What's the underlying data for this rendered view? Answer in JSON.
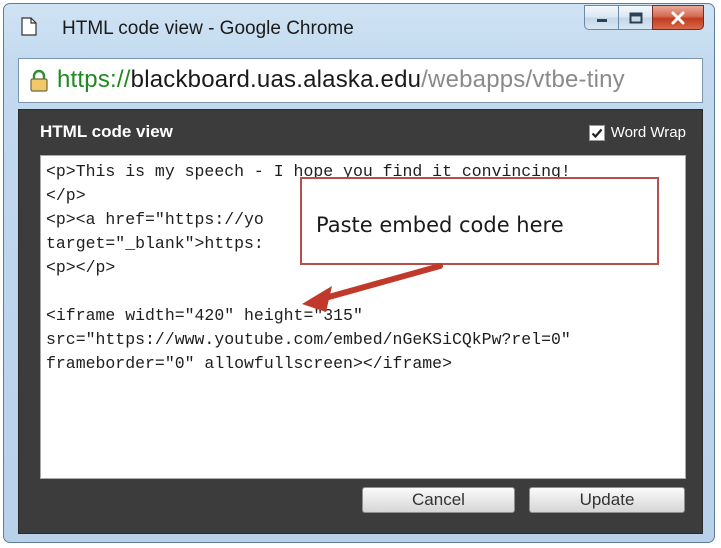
{
  "window": {
    "title": "HTML code view - Google Chrome",
    "icons": {
      "page": "page-icon",
      "minimize": "minimize-icon",
      "maximize": "maximize-icon",
      "close": "close-icon"
    }
  },
  "address_bar": {
    "scheme": "https://",
    "host": "blackboard.uas.alaska.edu",
    "path": "/webapps/vtbe-tiny",
    "lock_icon": "lock-icon",
    "lock_color": "#1f8a1f"
  },
  "dialog": {
    "title": "HTML code view",
    "word_wrap": {
      "label": "Word Wrap",
      "checked": true
    },
    "code_lines": [
      "<p>This is my speech - I hope you find it convincing!",
      "</p>",
      "<p><a href=\"https://yo",
      "target=\"_blank\">https:",
      "<p></p>",
      "",
      "<iframe width=\"420\" height=\"315\"",
      "src=\"https://www.youtube.com/embed/nGeKSiCQkPw?rel=0\"",
      "frameborder=\"0\" allowfullscreen></iframe>"
    ],
    "buttons": {
      "cancel": "Cancel",
      "update": "Update"
    }
  },
  "annotation": {
    "text": "Paste embed code here",
    "color": "#c0392b"
  }
}
